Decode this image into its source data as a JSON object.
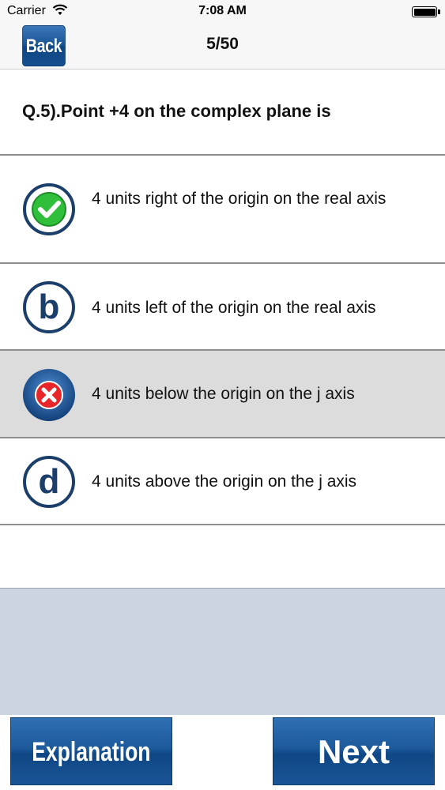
{
  "status_bar": {
    "carrier": "Carrier",
    "time": "7:08 AM"
  },
  "nav": {
    "back_label": "Back",
    "progress": "5/50"
  },
  "question": {
    "text": "Q.5).Point +4 on the complex plane is"
  },
  "options": [
    {
      "text": " 4 units right of the origin on the real axis",
      "state": "correct",
      "icon": "checkmark-icon"
    },
    {
      "text": "4 units left of the origin on the real axis",
      "state": "normal",
      "letter": "b",
      "icon": "letter-b-icon"
    },
    {
      "text": "4 units below the origin on the j axis",
      "state": "wrong",
      "icon": "wrong-x-icon"
    },
    {
      "text": "4 units above the origin on the j axis",
      "state": "normal",
      "letter": "d",
      "icon": "letter-d-icon"
    }
  ],
  "bottom": {
    "explanation_label": "Explanation",
    "next_label": "Next"
  },
  "colors": {
    "accent": "#1a5595",
    "correct": "#2fbf3a",
    "wrong": "#e8262a",
    "selected_row": "#dcdcdc",
    "footer_bg": "#cbd5e2"
  }
}
